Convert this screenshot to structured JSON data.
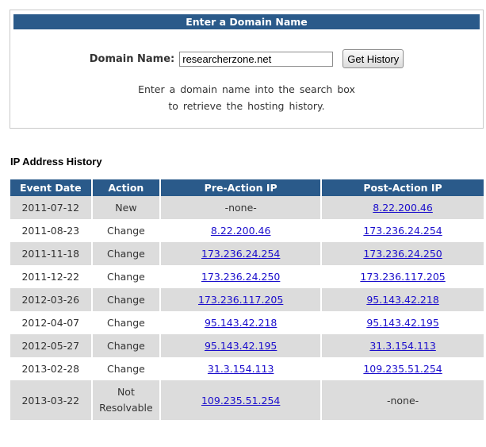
{
  "lookup": {
    "header": "Enter a Domain Name",
    "label": "Domain Name:",
    "input_value": "researcherzone.net",
    "button_label": "Get History",
    "hint_line1": "Enter a domain name into the search box",
    "hint_line2": "to retrieve the hosting history."
  },
  "history": {
    "title": "IP Address History",
    "columns": [
      "Event Date",
      "Action",
      "Pre-Action IP",
      "Post-Action IP"
    ],
    "rows": [
      {
        "date": "2011-07-12",
        "action": "New",
        "pre": "-none-",
        "post": "8.22.200.46"
      },
      {
        "date": "2011-08-23",
        "action": "Change",
        "pre": "8.22.200.46",
        "post": "173.236.24.254"
      },
      {
        "date": "2011-11-18",
        "action": "Change",
        "pre": "173.236.24.254",
        "post": "173.236.24.250"
      },
      {
        "date": "2011-12-22",
        "action": "Change",
        "pre": "173.236.24.250",
        "post": "173.236.117.205"
      },
      {
        "date": "2012-03-26",
        "action": "Change",
        "pre": "173.236.117.205",
        "post": "95.143.42.218"
      },
      {
        "date": "2012-04-07",
        "action": "Change",
        "pre": "95.143.42.218",
        "post": "95.143.42.195"
      },
      {
        "date": "2012-05-27",
        "action": "Change",
        "pre": "95.143.42.195",
        "post": "31.3.154.113"
      },
      {
        "date": "2013-02-28",
        "action": "Change",
        "pre": "31.3.154.113",
        "post": "109.235.51.254"
      },
      {
        "date": "2013-03-22",
        "action_line1": "Not",
        "action_line2": "Resolvable",
        "pre": "109.235.51.254",
        "post": "-none-"
      }
    ]
  }
}
